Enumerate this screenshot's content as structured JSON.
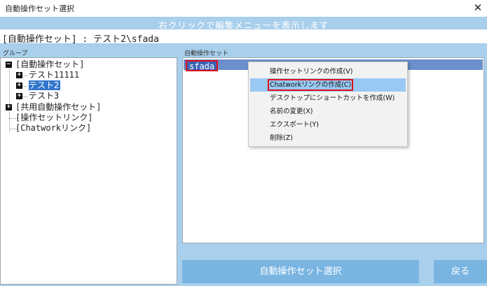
{
  "window": {
    "title": "自動操作セット選択",
    "close_glyph": "✕"
  },
  "hint_text": "右クリックで編集メニューを表示します",
  "path_text": "[自動操作セット] : テスト2\\sfada",
  "left_panel": {
    "label": "グループ",
    "tree": [
      {
        "label": "[自動操作セット]",
        "toggle": "−"
      },
      {
        "label": "テスト11111",
        "toggle": "+"
      },
      {
        "label": "テスト2",
        "toggle": "+",
        "selected": true
      },
      {
        "label": "テスト3",
        "toggle": "+"
      },
      {
        "label": "[共用自動操作セット]",
        "toggle": "+"
      },
      {
        "label": "[操作セットリンク]"
      },
      {
        "label": "[Chatworkリンク]"
      }
    ]
  },
  "right_panel": {
    "label": "自動操作セット",
    "items": [
      "sfada"
    ]
  },
  "context_menu": {
    "items": [
      "操作セットリンクの作成(V)",
      "Chatworkリンクの作成(C)",
      "デスクトップにショートカットを作成(W)",
      "名前の変更(X)",
      "エクスポート(Y)",
      "削除(Z)"
    ],
    "highlighted_index": 1
  },
  "buttons": {
    "select": "自動操作セット選択",
    "back": "戻る"
  },
  "colors": {
    "background": "#a8cfec",
    "selection": "#3377cc",
    "highlight_outline": "#e0101a",
    "menu_highlight": "#99c9f2",
    "button": "#7ab5e2"
  }
}
